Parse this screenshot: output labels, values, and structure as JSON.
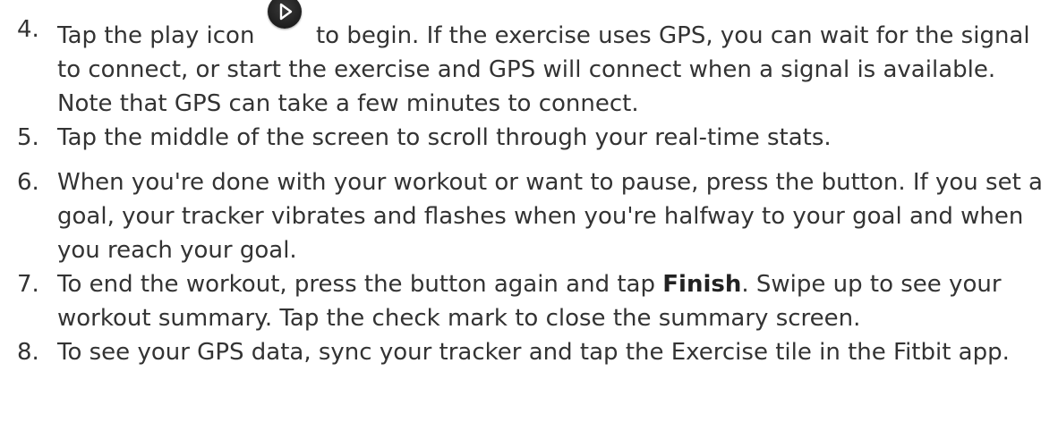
{
  "steps": [
    {
      "number": "4.",
      "text_before_icon": "Tap the play icon",
      "icon": "play-icon",
      "text_after_icon": "to begin. If the exercise uses GPS, you can wait for the signal to connect, or start the exercise and GPS will connect when a signal is available. Note that GPS can take a few minutes to connect."
    },
    {
      "number": "5.",
      "text": "Tap the middle of the screen to scroll through your real-time stats."
    },
    {
      "number": "6.",
      "text": "When you're done with your workout or want to pause, press the button. If you set a goal, your tracker vibrates and flashes when you're halfway to your goal and when you reach your goal."
    },
    {
      "number": "7.",
      "text_before_bold": "To end the workout, press the button again and tap",
      "bold": "Finish",
      "text_after_bold": ". Swipe up to see your workout summary. Tap the check mark to close the summary screen."
    },
    {
      "number": "8.",
      "text": "To see your GPS data, sync your tracker and tap the Exercise tile in the Fitbit app."
    }
  ]
}
